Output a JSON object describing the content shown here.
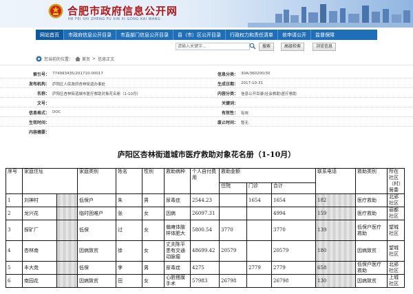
{
  "site": {
    "title": "合肥市政府信息公开网",
    "pinyin": "HE FEI SHI ZHENG FU XIN XI GONG KAI WANG"
  },
  "nav": {
    "items": [
      {
        "label": "网站首页",
        "active": true
      },
      {
        "label": "市政府信息公开目录",
        "active": false
      },
      {
        "label": "市直部门信息公开目录",
        "active": false
      },
      {
        "label": "县（市）区公开目录",
        "active": false
      },
      {
        "label": "行政权力和责任清单",
        "active": false
      },
      {
        "label": "依申请公开",
        "active": false
      },
      {
        "label": "监督保障",
        "active": false
      }
    ]
  },
  "search": {
    "placeholder": "请输入关键字...",
    "search_label": "搜索",
    "advanced_label": "高级检索",
    "browse_label": "浏览信息"
  },
  "breadcrumb": {
    "prefix": "您当前的位置：",
    "home": "首页",
    "separator": ">",
    "current": "信息正文"
  },
  "meta": {
    "index_no_label": "索引号：",
    "index_no": "774993435/201710-00017",
    "info_category_label": "信息分类：",
    "info_category": "30A/360200/30",
    "publisher_label": "发布机构：",
    "publisher": "庐阳区人民政府杏林街道办事处",
    "generated_date_label": "生成日期：",
    "generated_date": "2017-10-31",
    "name_label": "名称：",
    "name": "庐阳区杏林街道城市医疗救助对象花名册（1-10月）",
    "content_category_label": "内容分类：",
    "content_category": "信息公开目录\\社会救助\\医疗救助",
    "doc_no_label": "文号：",
    "doc_no": "",
    "keywords_label": "关键词：",
    "keywords": "",
    "carrier_label": "信息格式：",
    "carrier": "DOC",
    "validity_label": "有效性：",
    "validity": "有效",
    "effective_date_label": "生效时间：",
    "effective_date": "",
    "abolish_date_label": "废止时间：",
    "abolish_date": "暂无",
    "summary_label": "内容摘要："
  },
  "document": {
    "title": "庐阳区杏林街道城市医疗救助对象花名册（1-10月）"
  },
  "roster": {
    "headers": {
      "seq": "序号",
      "family_address": "家庭住址",
      "family_category": "家庭类别",
      "name": "姓名",
      "sex": "性别",
      "illness": "救助病种",
      "self_pay": "个人自付费用",
      "amount": "救助金额",
      "inpatient": "住院",
      "outpatient": "门诊",
      "total": "合计",
      "phone": "联系电话",
      "relief_category": "救助类别",
      "community": "所在社区（村）居委"
    },
    "rows": [
      {
        "seq": "1",
        "addr": "刘神村",
        "cat": "低保户",
        "name": "朱",
        "sex": "男",
        "ill": "尿毒症",
        "self": "2544.23",
        "inp": "",
        "outp": "1654",
        "total": "1654",
        "phone": "182",
        "relief": "医疗救助",
        "comm": "北郢社区"
      },
      {
        "seq": "2",
        "addr": "龙兴花",
        "cat": "临时困难户",
        "name": "张",
        "sex": "女",
        "ill": "因病",
        "self": "26097.31",
        "inp": "",
        "outp": "",
        "total": "4994",
        "phone": "159",
        "relief": "医疗救助",
        "comm": "丽都社区"
      },
      {
        "seq": "3",
        "addr": "探矿厂",
        "cat": "低保",
        "name": "过",
        "sex": "女",
        "ill": "偏瘫体胺样体肥大",
        "self": "5800.54",
        "inp": "3770",
        "outp": "",
        "total": "3770",
        "phone": "139",
        "relief": "低保户医疗救助",
        "comm": "望城社区"
      },
      {
        "seq": "4",
        "addr": "杏林南",
        "cat": "因病致贫",
        "name": "徐",
        "sex": "女",
        "ill": "丈夫陈平患有交通动脉瘤",
        "self": "48699.42",
        "inp": "20579",
        "outp": "",
        "total": "20579",
        "phone": "180",
        "relief": "因病致贫",
        "comm": "望城社区"
      },
      {
        "seq": "5",
        "addr": "丰大苑",
        "cat": "低保",
        "name": "李",
        "sex": "男",
        "ill": "尿毒症",
        "self": "4275",
        "inp": "",
        "outp": "2779",
        "total": "2779",
        "phone": "658",
        "relief": "低保户医疗救助",
        "comm": "北郢社区"
      },
      {
        "seq": "6",
        "addr": "南园花",
        "cat": "因病致贫",
        "name": "田",
        "sex": "女",
        "ill": "心脏搭膜手术",
        "self": "57983",
        "inp": "26798",
        "outp": "",
        "total": "26798",
        "phone": "130",
        "relief": "因病致贫",
        "comm": "上城社区"
      }
    ]
  }
}
